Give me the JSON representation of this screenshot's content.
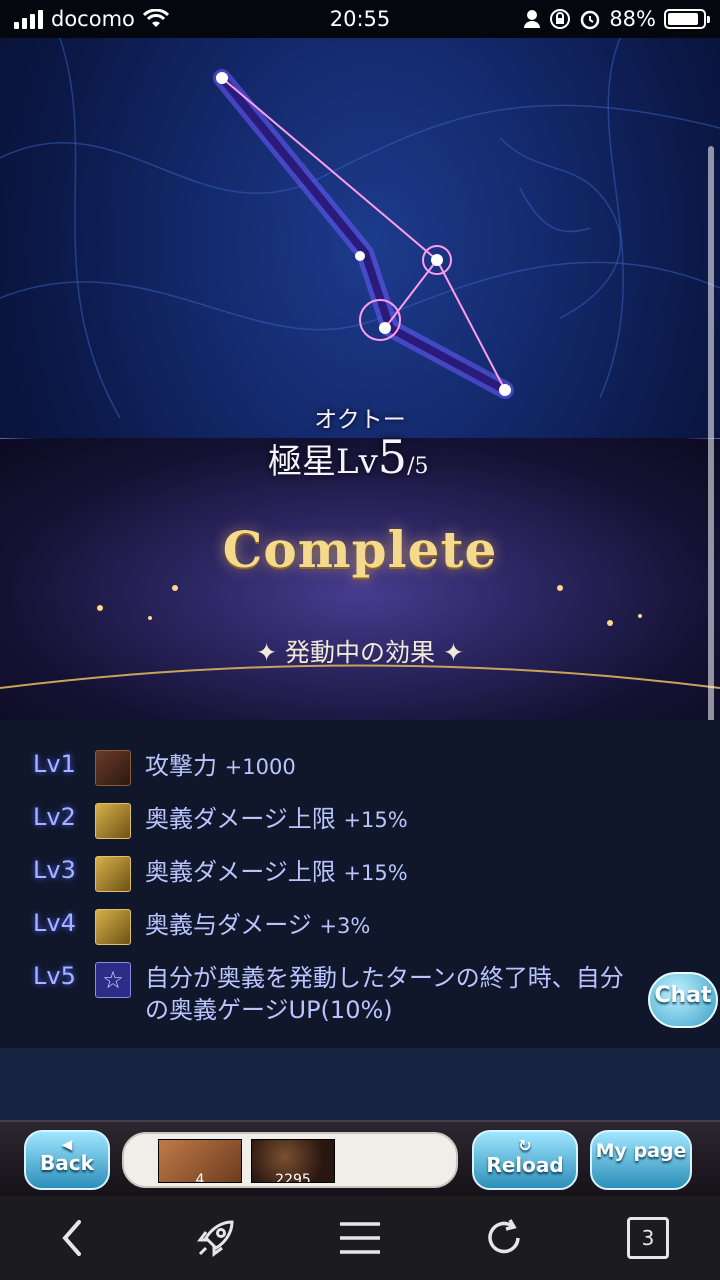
{
  "status_bar": {
    "carrier": "docomo",
    "time": "20:55",
    "battery": "88%",
    "battery_level": 0.88,
    "icons": [
      "signal-icon",
      "wifi-icon",
      "person-icon",
      "lock-rotation-icon",
      "alarm-icon",
      "battery-icon"
    ]
  },
  "constellation": {
    "name_kana": "オクトー",
    "rank_prefix": "極星",
    "rank_lv": "Lv",
    "rank_current": "5",
    "rank_max": "/5",
    "status": "Complete"
  },
  "effects": {
    "title": "発動中の効果",
    "items": [
      {
        "level": "Lv1",
        "icon": "attack-up-icon",
        "text": "攻撃力",
        "value": "+1000"
      },
      {
        "level": "Lv2",
        "icon": "ougi-damage-cap-icon",
        "text": "奥義ダメージ上限",
        "value": "+15%"
      },
      {
        "level": "Lv3",
        "icon": "ougi-damage-cap-icon",
        "text": "奥義ダメージ上限",
        "value": "+15%"
      },
      {
        "level": "Lv4",
        "icon": "ougi-damage-icon",
        "text": "奥義与ダメージ",
        "value": "+3%"
      },
      {
        "level": "Lv5",
        "icon": "star-icon",
        "text": "自分が奥義を発動したターンの終了時、自分の奥義ゲージUP(10%)",
        "value": ""
      }
    ]
  },
  "chat_label": "Chat",
  "game_nav": {
    "back_label": "Back",
    "reload_label": "Reload",
    "mypage_label": "My page",
    "item1_count": "4",
    "item2_count": "2295"
  },
  "browser_toolbar": {
    "tabs_count": "3"
  },
  "colors": {
    "effect_text": "#b9c4ff",
    "complete_gold": "#f5d98c",
    "game_button": "#2d8fb8"
  }
}
